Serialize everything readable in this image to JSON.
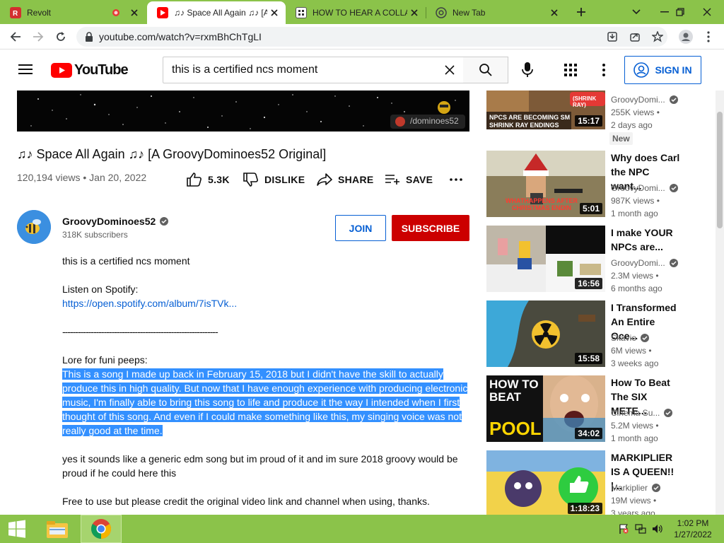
{
  "browser": {
    "tabs": [
      {
        "title": "Revolt"
      },
      {
        "title": "♫♪ Space All Again ♫♪ [A"
      },
      {
        "title": "HOW TO HEAR A COLLA"
      },
      {
        "title": "New Tab"
      }
    ],
    "url": "youtube.com/watch?v=rxmBhChTgLI"
  },
  "yt": {
    "logo_text": "YouTube",
    "search_value": "this is a certified ncs moment",
    "sign_in": "SIGN IN"
  },
  "video": {
    "title": "♫♪ Space All Again ♫♪ [A GroovyDominoes52 Original]",
    "meta": "120,194 views • Jan 20, 2022",
    "watermark": "/dominoes52",
    "likes": "5.3K",
    "dislike": "DISLIKE",
    "share": "SHARE",
    "save": "SAVE"
  },
  "channel": {
    "name": "GroovyDominoes52",
    "subs": "318K subscribers",
    "join": "JOIN",
    "subscribe": "SUBSCRIBE"
  },
  "description": {
    "l1": "this is a certified ncs moment",
    "l2": "Listen on Spotify:",
    "link": "https://open.spotify.com/album/7isTVk...",
    "sep": "------------------------------------------------------------",
    "l3": "Lore for funi peeps:",
    "sel1": "This is a song I made up back in February 15, 2018 but I didn't have the skill to actually",
    "sel2": "produce this in high quality. But now that I have enough experience with producing electronic",
    "sel3": "music, I'm finally able to bring this song to life and produce it the way I intended when I first",
    "sel4": "thought of this song. And even if I could make something like this, my singing voice was not",
    "sel5": "really good at the time.",
    "l4a": "yes it sounds like a generic edm song but im proud of it and im sure 2018 groovy would be",
    "l4b": "proud if he could here this",
    "l5": "Free to use but please credit the original video link and channel when using, thanks."
  },
  "recs": [
    {
      "thumb_text": "NPCS ARE BECOMING SM SHRINK RAY ENDINGS",
      "badge_text": "(SHRINK RAY)",
      "duration": "15:17",
      "channel": "GroovyDomi...",
      "views": "255K views •",
      "age": "2 days ago",
      "badge": "New"
    },
    {
      "title": "Why does Carl the NPC want...",
      "thumb_text": "WHATHAPPENS AFTER CHRISTMAS ENDIN",
      "duration": "5:01",
      "channel": "GroovyDomi...",
      "views": "987K views •",
      "age": "1 month ago"
    },
    {
      "title": "I make YOUR NPCs are...",
      "duration": "16:56",
      "channel": "GroovyDomi...",
      "views": "2.3M views •",
      "age": "6 months ago"
    },
    {
      "title": "I Transformed An Entire Oce...",
      "duration": "15:58",
      "channel": "Skavio",
      "views": "6M views •",
      "age": "3 weeks ago"
    },
    {
      "title": "How To Beat The SIX METE...",
      "thumb_text_1": "HOW TO BEAT",
      "thumb_text_2": "POOL",
      "duration": "34:02",
      "channel": "Cinema Su...",
      "views": "5.2M views •",
      "age": "1 month ago"
    },
    {
      "title": "MARKIPLIER IS A QUEEN!! |...",
      "duration": "1:18:23",
      "channel": "Markiplier",
      "views": "19M views •",
      "age": "3 years ago"
    }
  ],
  "taskbar": {
    "time": "1:02 PM",
    "date": "1/27/2022"
  },
  "colors": {
    "accent_green": "#8bc34a",
    "yt_red": "#ff0000",
    "subscribe_red": "#cc0000",
    "link_blue": "#065fd4",
    "selection": "#3390ff"
  }
}
